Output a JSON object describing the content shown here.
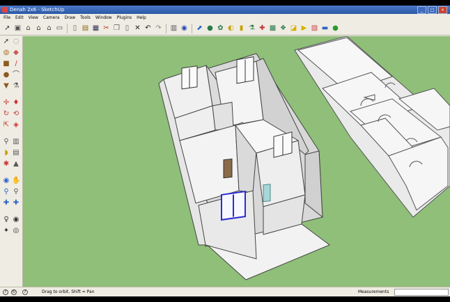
{
  "window": {
    "title": "Denah 2x6 - SketchUp",
    "controls": [
      "_",
      "□",
      "×"
    ]
  },
  "menu": [
    "File",
    "Edit",
    "View",
    "Camera",
    "Draw",
    "Tools",
    "Window",
    "Plugins",
    "Help"
  ],
  "toolbar_icons": [
    "select-icon",
    "component-icon",
    "home-view-icon",
    "front-view-icon",
    "top-view-icon",
    "right-view-icon",
    "back-view-icon",
    "new-icon",
    "open-icon",
    "save-icon",
    "cut-icon",
    "copy-icon",
    "paste-icon",
    "erase-icon",
    "undo-icon",
    "redo-icon",
    "print-icon",
    "user-icon",
    "orbit-icon",
    "pan-icon",
    "zoom-icon",
    "shadow-icon",
    "fog-icon",
    "tape-icon",
    "dimension-icon",
    "protractor-icon",
    "text-icon",
    "axes-icon",
    "3d-text-icon",
    "section-icon",
    "styles-icon",
    "layers-icon",
    "warehouse-icon"
  ],
  "status": {
    "hint": "Drag to orbit.  Shift = Pan",
    "measurements_label": "Measurements",
    "measurements_value": ""
  },
  "colors": {
    "viewport": "#8fbf78",
    "ui": "#efece3",
    "titlebar": "#2a57a6",
    "window_highlight": "#2b2bd0"
  }
}
